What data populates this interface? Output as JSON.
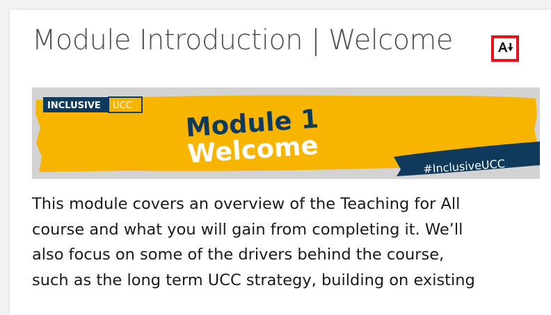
{
  "page": {
    "title": "Module Introduction | Welcome",
    "accessibility_button_label": "Accessibility options"
  },
  "banner": {
    "tag_left": "INCLUSIVE",
    "tag_right": "UCC",
    "heading_line1": "Module 1",
    "heading_line2": "Welcome",
    "hashtag": "#InclusiveUCC"
  },
  "content": {
    "lines": [
      "This module covers an overview of the Teaching for All",
      "course and what you will gain from completing it. We’ll",
      "also focus on some of the drivers behind the course,",
      "such as the long term UCC strategy, building on existing"
    ]
  },
  "colors": {
    "accent_yellow": "#f7b400",
    "navy": "#0f3a5c",
    "highlight_red": "#e8101b",
    "banner_grey": "#d3d3d3"
  },
  "icons": {
    "accessibility": "font-size-a-arrow-down-icon"
  }
}
